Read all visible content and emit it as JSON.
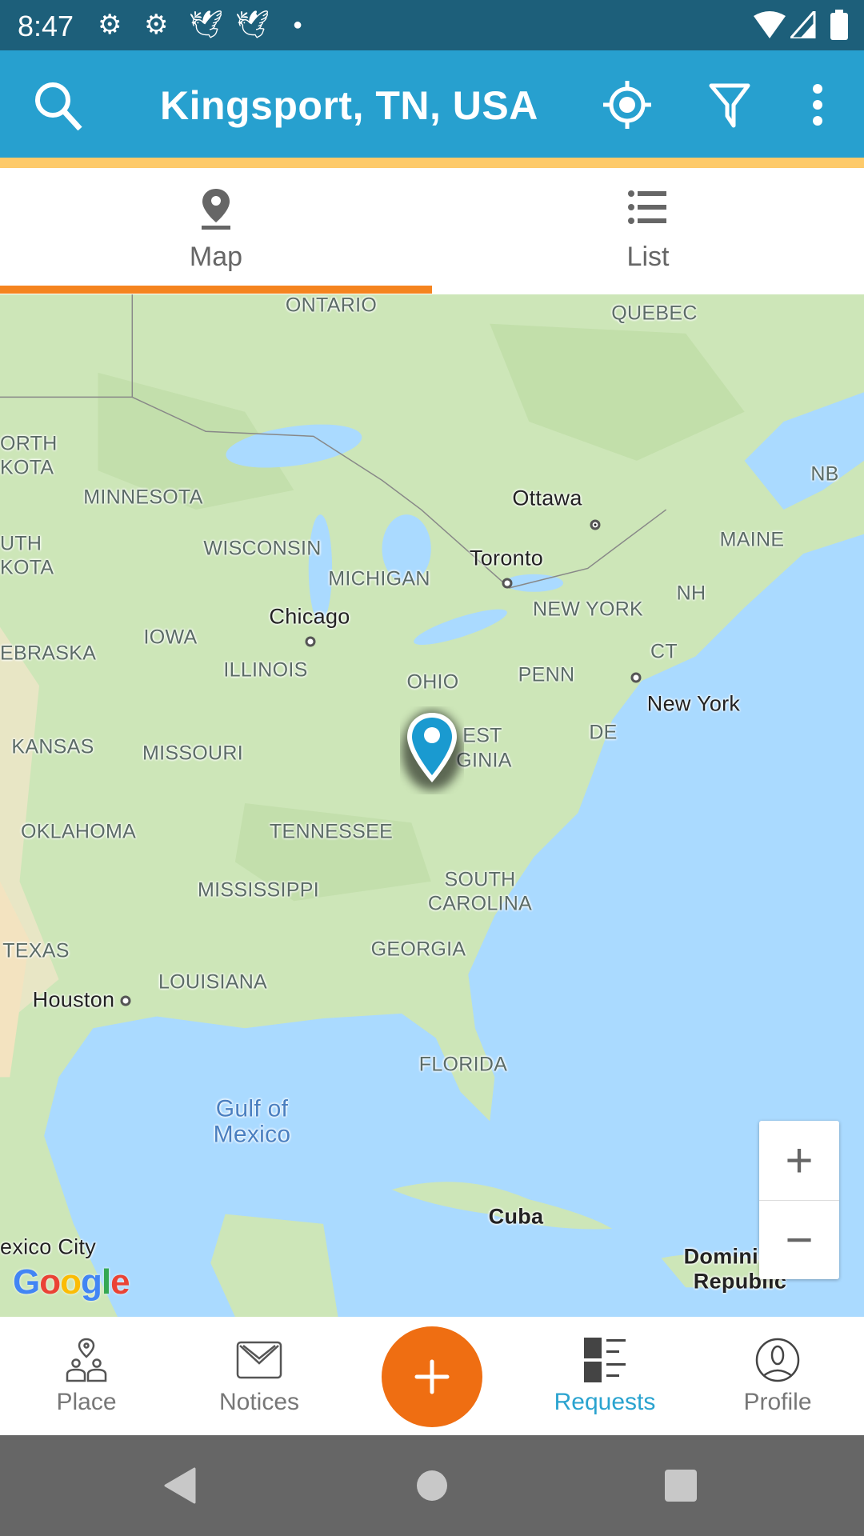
{
  "status_bar": {
    "time": "8:47",
    "icons": [
      "gear-icon",
      "gear-icon",
      "bird-icon",
      "bird-icon",
      "dot-icon",
      "wifi-icon",
      "signal-icon",
      "battery-icon"
    ]
  },
  "app_bar": {
    "title": "Kingsport, TN, USA",
    "icons": [
      "search-icon",
      "my-location-icon",
      "filter-icon",
      "more-vert-icon"
    ]
  },
  "tabs": [
    {
      "label": "Map",
      "icon": "map-pin-icon",
      "active": true
    },
    {
      "label": "List",
      "icon": "list-icon",
      "active": false
    }
  ],
  "map": {
    "labels": {
      "ontario": "ONTARIO",
      "quebec": "QUEBEC",
      "north_dakota_1": "ORTH",
      "north_dakota_2": "KOTA",
      "minnesota": "MINNESOTA",
      "ottawa": "Ottawa",
      "nb": "NB",
      "south_dakota_1": "UTH",
      "south_dakota_2": "KOTA",
      "wisconsin": "WISCONSIN",
      "toronto": "Toronto",
      "maine": "MAINE",
      "michigan": "MICHIGAN",
      "nh": "NH",
      "chicago": "Chicago",
      "new_york_state": "NEW YORK",
      "iowa": "IOWA",
      "nebraska": "EBRASKA",
      "ct": "CT",
      "illinois": "ILLINOIS",
      "ohio": "OHIO",
      "penn": "PENN",
      "new_york_city": "New York",
      "kansas": "KANSAS",
      "missouri": "MISSOURI",
      "de": "DE",
      "west_virginia_1": "EST",
      "west_virginia_2": "GINIA",
      "oklahoma": "OKLAHOMA",
      "tennessee": "TENNESSEE",
      "south_carolina_1": "SOUTH",
      "south_carolina_2": "CAROLINA",
      "mississippi": "MISSISSIPPI",
      "georgia": "GEORGIA",
      "texas": "TEXAS",
      "louisiana": "LOUISIANA",
      "houston": "Houston",
      "florida": "FLORIDA",
      "gulf_1": "Gulf of",
      "gulf_2": "Mexico",
      "cuba": "Cuba",
      "mexico_city": "exico City",
      "dominican_1": "Dominican",
      "dominican_2": "Republic"
    },
    "attribution": "Google",
    "zoom_in": "+",
    "zoom_out": "−",
    "marker_color": "#1a9ad0",
    "land_color": "#cde6b8",
    "water_color": "#aadaff"
  },
  "bottom_nav": [
    {
      "label": "Place",
      "icon": "place-people-icon",
      "active": false
    },
    {
      "label": "Notices",
      "icon": "mail-icon",
      "active": false
    },
    {
      "label": "",
      "icon": "plus-icon",
      "fab": true
    },
    {
      "label": "Requests",
      "icon": "requests-icon",
      "active": true
    },
    {
      "label": "Profile",
      "icon": "profile-icon",
      "active": false
    }
  ],
  "colors": {
    "status_bar": "#1d5f7a",
    "app_bar": "#27a0cf",
    "accent_stripe": "#fdca6a",
    "tab_indicator": "#f5841f",
    "fab": "#ef6e12",
    "active_nav": "#2aa3cf"
  }
}
